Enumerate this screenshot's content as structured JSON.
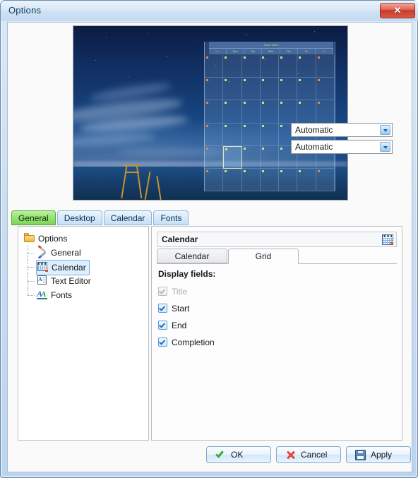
{
  "window": {
    "title": "Options",
    "close_label": "✕",
    "close_icon": "close-icon"
  },
  "preview": {
    "calendar_overlay": {
      "month_title": "June 2010",
      "day_headers": [
        "Sun",
        "Mon",
        "Tue",
        "Wed",
        "Thu",
        "Fri",
        "Sat"
      ]
    }
  },
  "outer_tabs": [
    {
      "label": "General",
      "active": true
    },
    {
      "label": "Desktop",
      "active": false
    },
    {
      "label": "Calendar",
      "active": false
    },
    {
      "label": "Fonts",
      "active": false
    }
  ],
  "tree": {
    "root": {
      "label": "Options",
      "icon": "folder-icon"
    },
    "items": [
      {
        "label": "General",
        "icon": "tools-icon",
        "selected": false
      },
      {
        "label": "Calendar",
        "icon": "calendar-icon",
        "selected": true
      },
      {
        "label": "Text Editor",
        "icon": "text-document-icon",
        "selected": false
      },
      {
        "label": "Fonts",
        "icon": "fonts-icon",
        "selected": false
      }
    ]
  },
  "detail": {
    "header_title": "Calendar",
    "header_icon": "calendar-icon",
    "inner_tabs": [
      {
        "label": "Calendar",
        "active": false
      },
      {
        "label": "Grid",
        "active": true
      }
    ],
    "fields_label": "Display fields:",
    "fields": [
      {
        "label": "Title",
        "checked": true,
        "disabled": true,
        "combo": null
      },
      {
        "label": "Start",
        "checked": true,
        "disabled": false,
        "combo": "Automatic"
      },
      {
        "label": "End",
        "checked": true,
        "disabled": false,
        "combo": "Automatic"
      },
      {
        "label": "Completion",
        "checked": true,
        "disabled": false,
        "combo": null
      }
    ],
    "combo_options": [
      "Automatic"
    ]
  },
  "footer": {
    "ok_label": "OK",
    "cancel_label": "Cancel",
    "apply_label": "Apply"
  },
  "colors": {
    "accent_tab_active": "#96e272",
    "title_text": "#0b3c63",
    "close_button": "#c73b2c",
    "checkbox_check": "#1b6fc4"
  }
}
